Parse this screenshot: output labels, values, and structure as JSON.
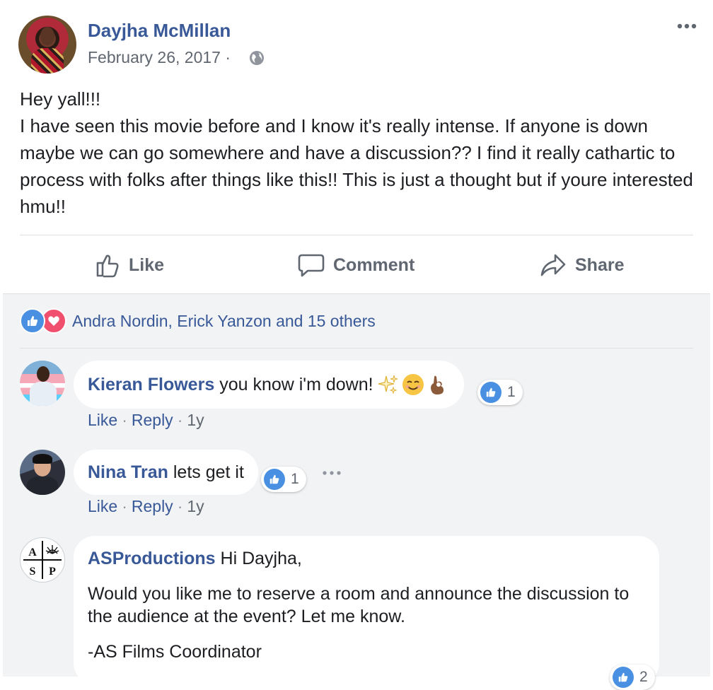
{
  "post": {
    "author": "Dayjha McMillan",
    "date": "February 26, 2017",
    "date_separator": "·",
    "privacy_icon": "globe-icon",
    "text_lines": [
      "Hey yall!!!",
      "I have seen this movie before and I know it's really intense. If anyone is down maybe we can go somewhere and have a discussion?? I find it really cathartic to process with folks after things like this!! This is just a thought but if youre interested hmu!!"
    ],
    "actions": {
      "like": "Like",
      "comment": "Comment",
      "share": "Share"
    }
  },
  "reactions": {
    "summary": "Andra Nordin, Erick Yanzon and 15 others",
    "types": [
      "like-icon",
      "love-icon"
    ]
  },
  "comments": [
    {
      "author": "Kieran Flowers",
      "text": "you know i'm down!",
      "emojis": [
        "sparkles-emoji",
        "smiling-face-emoji",
        "ok-hand-emoji"
      ],
      "likes": "1",
      "actions": {
        "like": "Like",
        "reply": "Reply",
        "age": "1y"
      }
    },
    {
      "author": "Nina Tran",
      "text": "lets get it",
      "likes": "1",
      "actions": {
        "like": "Like",
        "reply": "Reply",
        "age": "1y"
      }
    },
    {
      "author": "ASProductions",
      "text_first": "Hi Dayjha,",
      "text_body": "Would you like me to reserve a room and announce the discussion to the audience at the event? Let me know.",
      "signature": "-AS Films Coordinator",
      "likes": "2",
      "logo_letters": [
        "A",
        "S",
        "P"
      ]
    }
  ],
  "colors": {
    "link": "#385898",
    "secondary": "#616770",
    "like_blue": "#4a90e2",
    "love_red": "#f0506e",
    "comment_area_bg": "#f2f3f5"
  },
  "separator": "·"
}
